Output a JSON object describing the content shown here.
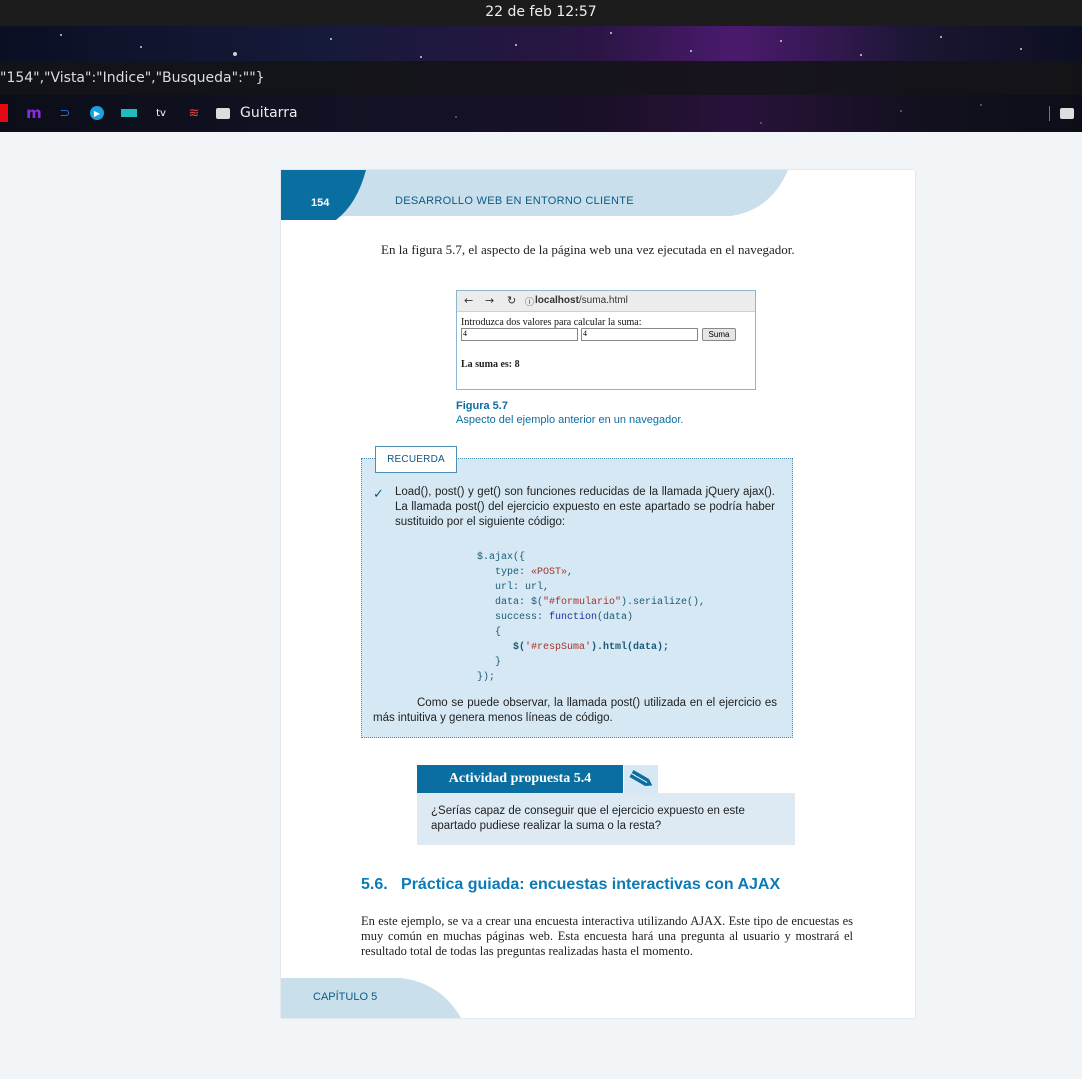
{
  "system_bar": {
    "datetime": "22 de feb  12:57"
  },
  "browser": {
    "url_fragment": "\"154\",\"Vista\":\"Indice\",\"Busqueda\":\"\"}",
    "bookmarks": [
      {
        "label": "",
        "icon": "netflix-icon",
        "color": "#e50914"
      },
      {
        "label": "m",
        "icon": "hbo-max-icon",
        "color": "#8a2be2"
      },
      {
        "label": "",
        "icon": "disney-plus-icon",
        "color": "#2a6bd8"
      },
      {
        "label": "",
        "icon": "prime-video-icon",
        "color": "#1aa1e0"
      },
      {
        "label": "",
        "icon": "filmin-icon",
        "color": "#1fbfb8"
      },
      {
        "label": "tv",
        "icon": "apple-tv-icon",
        "color": "#ffffff"
      },
      {
        "label": "",
        "icon": "stadia-icon",
        "color": "#e8453c"
      },
      {
        "label": "Guitarra",
        "icon": "folder-icon",
        "color": "#dddddd"
      }
    ]
  },
  "book_page": {
    "page_number": "154",
    "running_title": "DESARROLLO WEB EN ENTORNO CLIENTE",
    "intro": "En la figura 5.7, el aspecto de la página web una vez ejecutada en el navegador.",
    "figure": {
      "url_host": "localhost",
      "url_path": "/suma.html",
      "prompt": "Introduzca dos valores para calcular la suma:",
      "value1": "4",
      "value2": "4",
      "button": "Suma",
      "result": "La suma es: 8",
      "title": "Figura 5.7",
      "caption": "Aspecto del ejemplo anterior en un navegador."
    },
    "recuerda": {
      "tab": "RECUERDA",
      "text": "Load(), post() y get() son funciones reducidas de la llamada jQuery ajax(). La llamada post() del ejercicio expuesto en este apartado se podría haber sustituido por el siguiente código:",
      "code": {
        "l1": "$.ajax({",
        "l2a": "   type: ",
        "l2b": "«POST»",
        "l2c": ",",
        "l3": "   url: url,",
        "l4a": "   data: $(",
        "l4b": "\"#formulario\"",
        "l4c": ").serialize(),",
        "l5a": "   success: ",
        "l5b": "function",
        "l5c": "(data)",
        "l6": "   {",
        "l7a": "      $(",
        "l7b": "'#respSuma'",
        "l7c": ").html(data);",
        "l8": "   }",
        "l9": "});"
      },
      "after": "Como se puede observar, la llamada post() utilizada en el ejercicio es más intuitiva y genera menos líneas de código."
    },
    "actividad": {
      "title": "Actividad propuesta 5.4",
      "text": "¿Serías capaz de conseguir que el ejercicio expuesto en este apartado pudiese realizar la suma o la resta?"
    },
    "section": {
      "title": "5.6.   Práctica guiada: encuestas interactivas con AJAX",
      "body": "En este ejemplo, se va a crear una encuesta interactiva utilizando AJAX. Este tipo de encuestas es muy común en muchas páginas web. Esta encuesta hará una pregunta al usuario y mostrará el resultado total de todas las preguntas realizadas hasta el momento."
    },
    "footer": "CAPÍTULO 5"
  }
}
